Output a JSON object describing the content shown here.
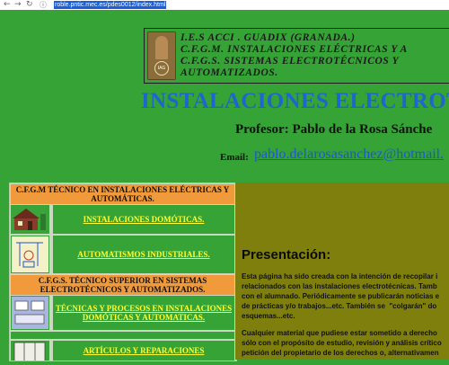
{
  "browser": {
    "back_icon": "arrow-left-icon",
    "forward_icon": "arrow-right-icon",
    "reload_icon": "reload-icon",
    "info_icon": "info-icon",
    "url": "roble.pntic.mec.es/pdes0012/index.html"
  },
  "header": {
    "line1": "I.E.S ACCI . GUADIX (GRANADA.)",
    "line2": "C.F.G.M. INSTALACIONES ELÉCTRICAS Y A",
    "line3": "C.F.G.S. SISTEMAS ELECTROTÉCNICOS Y",
    "line4": "AUTOMATIZADOS.",
    "logo_text": "IAG"
  },
  "title": "INSTALACIONES ELECTROT",
  "profesor": "Profesor: Pablo de la Rosa Sánche",
  "email": {
    "label": "Email:",
    "link": "pablo.delarosasanchez@hotmail."
  },
  "menu": {
    "section1": "C.F.G.M TÉCNICO EN INSTALACIONES ELÉCTRICAS Y AUTOMÁTICAS.",
    "item1": "INSTALACIONES DOMÓTICAS.",
    "item2": "AUTOMATISMOS INDUSTRIALES.",
    "section2": "C.F.G.S. TÉCNICO SUPERIOR EN SISTEMAS ELECTROTÉCNICOS Y AUTOMATIZADOS.",
    "item3": "TÉCNICAS Y PROCESOS EN INSTALACIONES DOMÓTICAS Y AUTOMATICAS.",
    "item4": "ARTÍCULOS Y REPARACIONES"
  },
  "content": {
    "title": "Presentación:",
    "para1": [
      "Esta página ha sido creada con la intención de recopilar i",
      "relacionados con las instalaciones electrotécnicas. Tamb",
      "con el alumnado. Periódicamente se publicarán noticias e",
      "de prácticas y/o trabajos...etc. También se  \"colgarán\" do",
      "esquemas...etc."
    ],
    "para2": [
      "Cualquier material que pudiese estar sometido a derecho",
      "sólo con el propósito de estudio, revisión y análisis crítico",
      "petición del propietario de los derechos o, alternativamen"
    ]
  }
}
